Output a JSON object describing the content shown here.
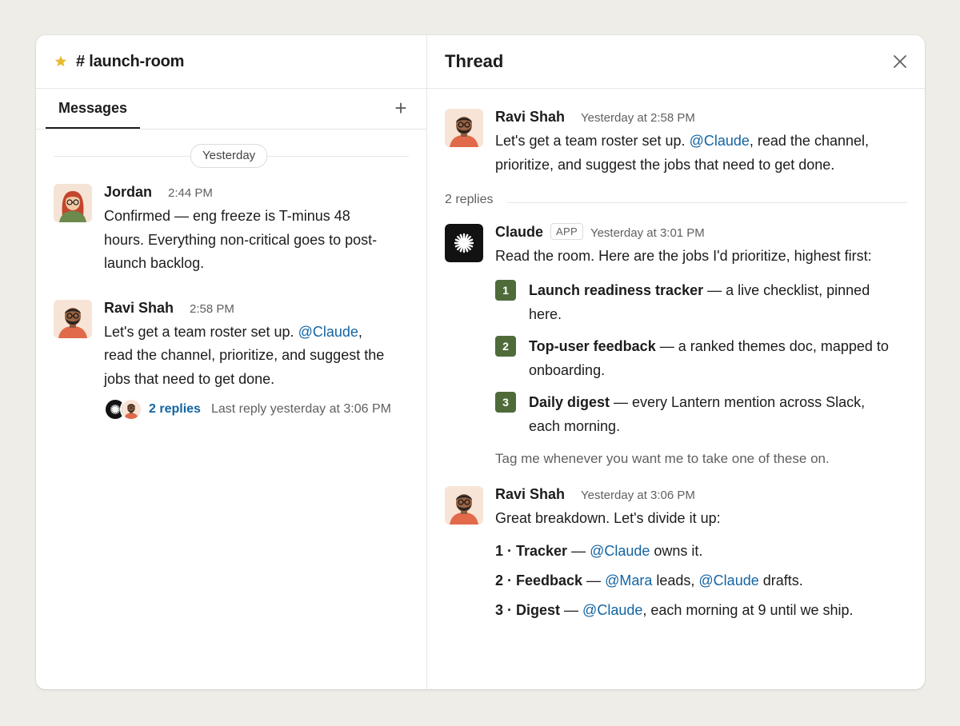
{
  "channel": {
    "name": "# launch-room"
  },
  "tabs": {
    "messages": "Messages"
  },
  "date_divider": "Yesterday",
  "messages": [
    {
      "author": "Jordan",
      "time": "2:44 PM",
      "lines": [
        "Confirmed — eng freeze is T-minus 48",
        "hours. Everything non-critical goes to post-",
        "launch backlog."
      ]
    },
    {
      "author": "Ravi Shah",
      "time": "2:58 PM",
      "line1_pre": "Let's get a team roster set up. ",
      "mention": "@Claude",
      "line1_post": ",",
      "line2": "read the channel, prioritize, and suggest the",
      "line3": "jobs that need to get done.",
      "replies_label": "2 replies",
      "last_reply": "Last reply yesterday at 3:06 PM"
    }
  ],
  "thread": {
    "title": "Thread",
    "root": {
      "author": "Ravi Shah",
      "time": "Yesterday at 2:58 PM",
      "line1_pre": "Let's get a team roster set up. ",
      "mention": "@Claude",
      "line1_post": ", read the channel,",
      "line2": "prioritize, and suggest the jobs that need to get done."
    },
    "reply_count": "2 replies",
    "claude_reply": {
      "author": "Claude",
      "badge": "APP",
      "time": "Yesterday at 3:01 PM",
      "intro": "Read the room. Here are the jobs I'd prioritize, highest first:",
      "items": [
        {
          "num": "1",
          "title": "Launch readiness tracker",
          "desc": " — a live checklist, pinned here."
        },
        {
          "num": "2",
          "title": "Top-user feedback",
          "desc": " — a ranked themes doc, mapped to onboarding."
        },
        {
          "num": "3",
          "title": "Daily digest",
          "desc": " — every Lantern mention across Slack, each morning."
        }
      ],
      "outro": "Tag me whenever you want me to take one of these on."
    },
    "ravi_reply": {
      "author": "Ravi Shah",
      "time": "Yesterday at 3:06 PM",
      "intro": "Great breakdown. Let's divide it up:",
      "plan": [
        {
          "label": "1 · Tracker",
          "sep": " — ",
          "m1": "@Claude",
          "rest": " owns it."
        },
        {
          "label": "2 · Feedback",
          "sep": " — ",
          "m1": "@Mara",
          "mid": " leads, ",
          "m2": "@Claude",
          "rest": " drafts."
        },
        {
          "label": "3 · Digest",
          "sep": " — ",
          "m1": "@Claude",
          "rest": ", each morning at 9 until we ship."
        }
      ]
    }
  },
  "colors": {
    "mention": "#1264a3",
    "badge_green": "#4f6b3a",
    "star": "#e8b92b"
  }
}
